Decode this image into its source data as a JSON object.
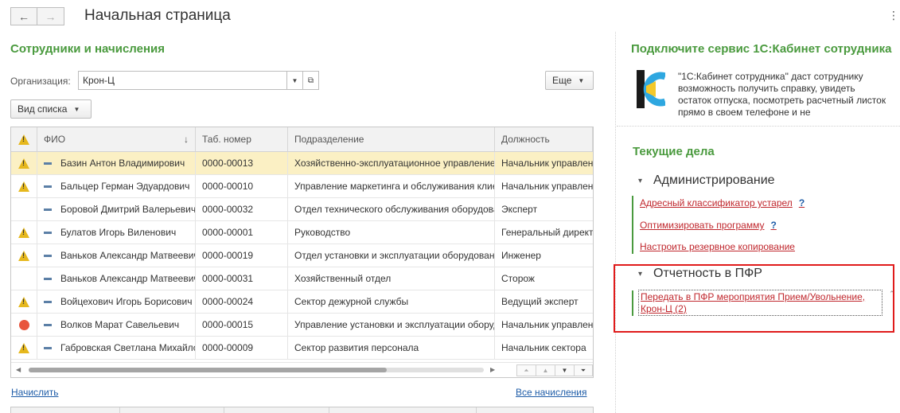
{
  "header": {
    "title": "Начальная страница",
    "back_icon": "←",
    "forward_icon": "→",
    "menu_icon": "⋮"
  },
  "left": {
    "title": "Сотрудники и начисления",
    "org_label": "Организация:",
    "org_value": "Крон-Ц",
    "more_button": "Еще",
    "view_button": "Вид списка",
    "link_calc": "Начислить",
    "link_all": "Все начисления"
  },
  "table": {
    "headers": {
      "fio": "ФИО",
      "tab": "Таб. номер",
      "dep": "Подразделение",
      "pos": "Должность"
    },
    "rows": [
      {
        "icon": "warning",
        "fio": "Базин Антон Владимирович",
        "tab": "0000-00013",
        "dep": "Хозяйственно-эксплуатационное управление",
        "pos": "Начальник управления"
      },
      {
        "icon": "warning",
        "fio": "Бальцер Герман Эдуардович",
        "tab": "0000-00010",
        "dep": "Управление маркетинга и обслуживания клиентов",
        "pos": "Начальник управления"
      },
      {
        "icon": "none",
        "fio": "Боровой Дмитрий Валерьевич",
        "tab": "0000-00032",
        "dep": "Отдел технического обслуживания оборудования",
        "pos": "Эксперт"
      },
      {
        "icon": "warning",
        "fio": "Булатов Игорь Виленович",
        "tab": "0000-00001",
        "dep": "Руководство",
        "pos": "Генеральный директор"
      },
      {
        "icon": "warning",
        "fio": "Ваньков Александр Матвеевич",
        "tab": "0000-00019",
        "dep": "Отдел установки и эксплуатации оборудования",
        "pos": "Инженер"
      },
      {
        "icon": "none",
        "fio": "Ваньков Александр Матвеевич",
        "tab": "0000-00031",
        "dep": "Хозяйственный отдел",
        "pos": "Сторож"
      },
      {
        "icon": "warning",
        "fio": "Войцехович Игорь Борисович",
        "tab": "0000-00024",
        "dep": "Сектор дежурной службы",
        "pos": "Ведущий эксперт"
      },
      {
        "icon": "error",
        "fio": "Волков Марат Савельевич",
        "tab": "0000-00015",
        "dep": "Управление установки и эксплуатации оборудования",
        "pos": "Начальник управления"
      },
      {
        "icon": "warning",
        "fio": "Габровская Светлана Михайловна",
        "tab": "0000-00009",
        "dep": "Сектор развития персонала",
        "pos": "Начальник сектора"
      }
    ]
  },
  "right": {
    "service_title": "Подключите сервис 1С:Кабинет сотрудника",
    "service_desc": "\"1С:Кабинет сотрудника\" даст сотруднику возможность получить справку, увидеть остаток отпуска, посмотреть расчетный листок прямо в своем телефоне и не",
    "tasks_title": "Текущие дела",
    "groups": [
      {
        "name": "Администрирование",
        "items": [
          {
            "label": "Адресный классификатор устарел",
            "help": "?"
          },
          {
            "label": "Оптимизировать программу",
            "help": "?"
          },
          {
            "label": "Настроить резервное копирование",
            "help": ""
          }
        ]
      },
      {
        "name": "Отчетность в ПФР",
        "items": [
          {
            "label": "Передать в ПФР мероприятия Прием/Увольнение, Крон-Ц (2)"
          }
        ]
      }
    ]
  },
  "colors": {
    "accent_green": "#4a9a3e",
    "task_red": "#c0272d",
    "link_blue": "#1f5da8",
    "highlight_box": "#e01b1b",
    "selected_row": "#fbf0c4"
  }
}
